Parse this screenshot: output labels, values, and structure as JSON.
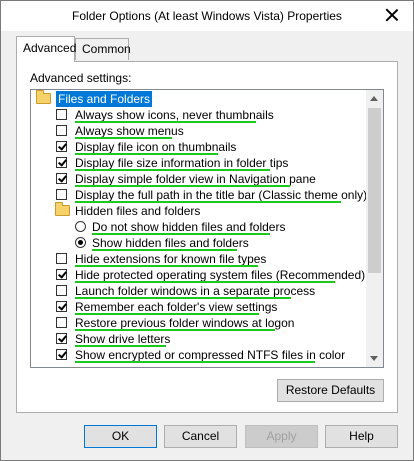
{
  "window": {
    "title": "Folder Options (At least Windows Vista) Properties"
  },
  "tabs": [
    {
      "label": "Advanced",
      "active": true
    },
    {
      "label": "Common",
      "active": false
    }
  ],
  "panel": {
    "settings_label": "Advanced settings:"
  },
  "tree": {
    "group_label": "Files and Folders",
    "items": [
      {
        "label": "Always show icons, never thumbnails",
        "checked": false
      },
      {
        "label": "Always show menus",
        "checked": false
      },
      {
        "label": "Display file icon on thumbnails",
        "checked": true
      },
      {
        "label": "Display file size information in folder tips",
        "checked": true
      },
      {
        "label": "Display simple folder view in Navigation pane",
        "checked": true
      },
      {
        "label": "Display the full path in the title bar (Classic theme only)",
        "checked": false
      }
    ],
    "hidden_group_label": "Hidden files and folders",
    "radios": [
      {
        "label": "Do not show hidden files and folders",
        "selected": false
      },
      {
        "label": "Show hidden files and folders",
        "selected": true
      }
    ],
    "items2": [
      {
        "label": "Hide extensions for known file types",
        "checked": false
      },
      {
        "label": "Hide protected operating system files (Recommended)",
        "checked": true
      },
      {
        "label": "Launch folder windows in a separate process",
        "checked": false
      },
      {
        "label": "Remember each folder's view settings",
        "checked": true
      },
      {
        "label": "Restore previous folder windows at logon",
        "checked": false
      },
      {
        "label": "Show drive letters",
        "checked": true
      },
      {
        "label": "Show encrypted or compressed NTFS files in color",
        "checked": true
      }
    ]
  },
  "buttons": {
    "restore_defaults": "Restore Defaults",
    "ok": "OK",
    "cancel": "Cancel",
    "apply": "Apply",
    "help": "Help"
  },
  "colors": {
    "selection": "#0078d7",
    "highlight_underline": "#1ec81e"
  }
}
